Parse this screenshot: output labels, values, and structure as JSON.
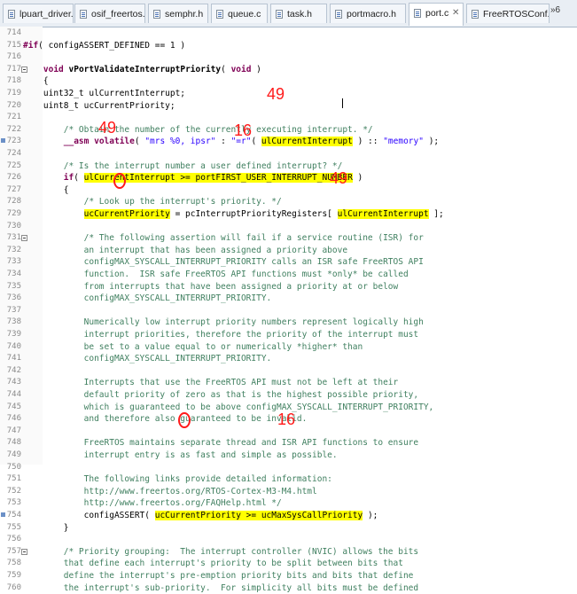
{
  "tabs": [
    {
      "label": "lpuart_driver.c"
    },
    {
      "label": "osif_freertos.c"
    },
    {
      "label": "semphr.h"
    },
    {
      "label": "queue.c"
    },
    {
      "label": "task.h"
    },
    {
      "label": "portmacro.h"
    },
    {
      "label": "port.c",
      "active": true
    },
    {
      "label": "FreeRTOSConf..."
    }
  ],
  "tab_close_glyph": "✕",
  "overflow_label": "»6",
  "lines": [
    {
      "n": "714",
      "parts": [
        {
          "t": ""
        }
      ]
    },
    {
      "n": "715",
      "parts": [
        {
          "t": "#if",
          "c": "kw"
        },
        {
          "t": "( configASSERT_DEFINED == 1 )"
        }
      ]
    },
    {
      "n": "716",
      "parts": [
        {
          "t": ""
        }
      ]
    },
    {
      "n": "717",
      "fold": true,
      "parts": [
        {
          "t": "    "
        },
        {
          "t": "void",
          "c": "kw"
        },
        {
          "t": " "
        },
        {
          "t": "vPortValidateInterruptPriority",
          "c": "fn"
        },
        {
          "t": "( "
        },
        {
          "t": "void",
          "c": "kw"
        },
        {
          "t": " )"
        }
      ]
    },
    {
      "n": "718",
      "parts": [
        {
          "t": "    {"
        }
      ]
    },
    {
      "n": "719",
      "parts": [
        {
          "t": "    uint32_t ulCurrentInterrupt;"
        }
      ]
    },
    {
      "n": "720",
      "parts": [
        {
          "t": "    uint8_t ucCurrentPriority;"
        }
      ]
    },
    {
      "n": "721",
      "parts": [
        {
          "t": ""
        }
      ]
    },
    {
      "n": "722",
      "parts": [
        {
          "t": "        /* Obtain the number of the currently executing interrupt. */",
          "c": "cm"
        }
      ]
    },
    {
      "n": "723",
      "mark": true,
      "parts": [
        {
          "t": "        "
        },
        {
          "t": "__asm",
          "c": "kw"
        },
        {
          "t": " "
        },
        {
          "t": "volatile",
          "c": "kw"
        },
        {
          "t": "( "
        },
        {
          "t": "\"mrs %0, ipsr\"",
          "c": "st"
        },
        {
          "t": " : "
        },
        {
          "t": "\"=r\"",
          "c": "st"
        },
        {
          "t": "( "
        },
        {
          "t": "ulCurrentInterrupt",
          "c": "hl"
        },
        {
          "t": " ) :: "
        },
        {
          "t": "\"memory\"",
          "c": "st"
        },
        {
          "t": " );"
        }
      ]
    },
    {
      "n": "724",
      "parts": [
        {
          "t": ""
        }
      ]
    },
    {
      "n": "725",
      "parts": [
        {
          "t": "        /* Is the interrupt number a user defined interrupt? */",
          "c": "cm"
        }
      ]
    },
    {
      "n": "726",
      "parts": [
        {
          "t": "        "
        },
        {
          "t": "if",
          "c": "kw"
        },
        {
          "t": "( "
        },
        {
          "t": "ulCurrentInterrupt >= portFIRST_USER_INTERRUPT_NUMBER",
          "c": "hl"
        },
        {
          "t": " )"
        }
      ]
    },
    {
      "n": "727",
      "parts": [
        {
          "t": "        {"
        }
      ]
    },
    {
      "n": "728",
      "parts": [
        {
          "t": "            /* Look up the interrupt's priority. */",
          "c": "cm"
        }
      ]
    },
    {
      "n": "729",
      "parts": [
        {
          "t": "            "
        },
        {
          "t": "ucCurrentPriority",
          "c": "hl"
        },
        {
          "t": " = pcInterruptPriorityRegisters[ "
        },
        {
          "t": "ulCurrentInterrupt",
          "c": "hl"
        },
        {
          "t": " ];"
        }
      ]
    },
    {
      "n": "730",
      "parts": [
        {
          "t": ""
        }
      ]
    },
    {
      "n": "731",
      "fold": true,
      "parts": [
        {
          "t": "            /* The following assertion will fail if a service routine (ISR) for",
          "c": "cm"
        }
      ]
    },
    {
      "n": "732",
      "parts": [
        {
          "t": "            an interrupt that has been assigned a priority above",
          "c": "cm"
        }
      ]
    },
    {
      "n": "733",
      "parts": [
        {
          "t": "            configMAX_SYSCALL_INTERRUPT_PRIORITY calls an ISR safe FreeRTOS API",
          "c": "cm"
        }
      ]
    },
    {
      "n": "734",
      "parts": [
        {
          "t": "            function.  ISR safe FreeRTOS API functions must *only* be called",
          "c": "cm"
        }
      ]
    },
    {
      "n": "735",
      "parts": [
        {
          "t": "            from interrupts that have been assigned a priority at or below",
          "c": "cm"
        }
      ]
    },
    {
      "n": "736",
      "parts": [
        {
          "t": "            configMAX_SYSCALL_INTERRUPT_PRIORITY.",
          "c": "cm"
        }
      ]
    },
    {
      "n": "737",
      "parts": [
        {
          "t": ""
        }
      ]
    },
    {
      "n": "738",
      "parts": [
        {
          "t": "            Numerically low interrupt priority numbers represent logically high",
          "c": "cm"
        }
      ]
    },
    {
      "n": "739",
      "parts": [
        {
          "t": "            interrupt priorities, therefore the priority of the interrupt must",
          "c": "cm"
        }
      ]
    },
    {
      "n": "740",
      "parts": [
        {
          "t": "            be set to a value equal to or numerically *higher* than",
          "c": "cm"
        }
      ]
    },
    {
      "n": "741",
      "parts": [
        {
          "t": "            configMAX_SYSCALL_INTERRUPT_PRIORITY.",
          "c": "cm"
        }
      ]
    },
    {
      "n": "742",
      "parts": [
        {
          "t": ""
        }
      ]
    },
    {
      "n": "743",
      "parts": [
        {
          "t": "            Interrupts that use the FreeRTOS API must not be left at their",
          "c": "cm"
        }
      ]
    },
    {
      "n": "744",
      "parts": [
        {
          "t": "            default priority of zero as that is the highest possible priority,",
          "c": "cm"
        }
      ]
    },
    {
      "n": "745",
      "parts": [
        {
          "t": "            which is guaranteed to be above configMAX_SYSCALL_INTERRUPT_PRIORITY,",
          "c": "cm"
        }
      ]
    },
    {
      "n": "746",
      "parts": [
        {
          "t": "            and therefore also guaranteed to be invalid.",
          "c": "cm"
        }
      ]
    },
    {
      "n": "747",
      "parts": [
        {
          "t": ""
        }
      ]
    },
    {
      "n": "748",
      "parts": [
        {
          "t": "            FreeRTOS maintains separate thread and ISR API functions to ensure",
          "c": "cm"
        }
      ]
    },
    {
      "n": "749",
      "parts": [
        {
          "t": "            interrupt entry is as fast and simple as possible.",
          "c": "cm"
        }
      ]
    },
    {
      "n": "750",
      "parts": [
        {
          "t": ""
        }
      ]
    },
    {
      "n": "751",
      "parts": [
        {
          "t": "            The following links provide detailed information:",
          "c": "cm"
        }
      ]
    },
    {
      "n": "752",
      "parts": [
        {
          "t": "            http://www.freertos.org/RTOS-Cortex-M3-M4.html",
          "c": "cm"
        }
      ]
    },
    {
      "n": "753",
      "parts": [
        {
          "t": "            http://www.freertos.org/FAQHelp.html */",
          "c": "cm"
        }
      ]
    },
    {
      "n": "754",
      "mark": true,
      "parts": [
        {
          "t": "            configASSERT( "
        },
        {
          "t": "ucCurrentPriority >= ucMaxSysCallPriority",
          "c": "hl"
        },
        {
          "t": " );"
        }
      ]
    },
    {
      "n": "755",
      "parts": [
        {
          "t": "        }"
        }
      ]
    },
    {
      "n": "756",
      "parts": [
        {
          "t": ""
        }
      ]
    },
    {
      "n": "757",
      "fold": true,
      "parts": [
        {
          "t": "        /* Priority grouping:  The interrupt controller (NVIC) allows the bits",
          "c": "cm"
        }
      ]
    },
    {
      "n": "758",
      "parts": [
        {
          "t": "        that define each interrupt's priority to be split between bits that",
          "c": "cm"
        }
      ]
    },
    {
      "n": "759",
      "parts": [
        {
          "t": "        define the interrupt's pre-emption priority bits and bits that define",
          "c": "cm"
        }
      ]
    },
    {
      "n": "760",
      "parts": [
        {
          "t": "        the interrupt's sub-priority.  For simplicity all bits must be defined",
          "c": "cm"
        }
      ]
    }
  ],
  "annotations": [
    "49",
    "49",
    "16",
    "0",
    "49",
    "0",
    "16"
  ]
}
